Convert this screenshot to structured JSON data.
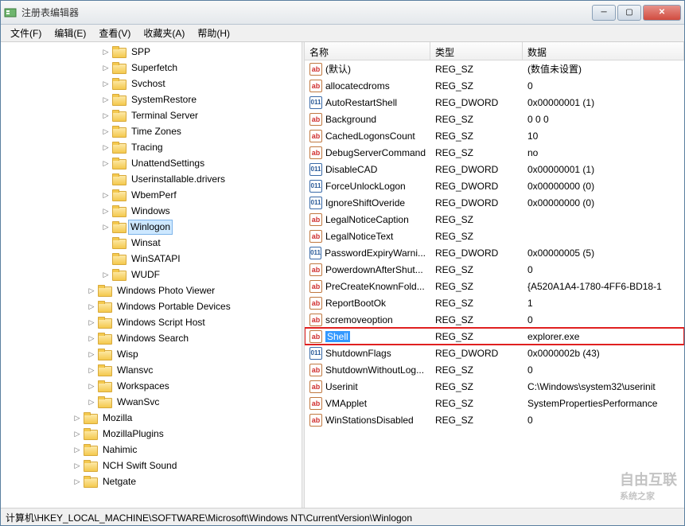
{
  "window": {
    "title": "注册表编辑器"
  },
  "menu": {
    "file": "文件(F)",
    "edit": "编辑(E)",
    "view": "查看(V)",
    "favorites": "收藏夹(A)",
    "help": "帮助(H)"
  },
  "tree": {
    "items": [
      {
        "depth": 7,
        "label": "SPP",
        "exp": true
      },
      {
        "depth": 7,
        "label": "Superfetch",
        "exp": true
      },
      {
        "depth": 7,
        "label": "Svchost",
        "exp": true
      },
      {
        "depth": 7,
        "label": "SystemRestore",
        "exp": true
      },
      {
        "depth": 7,
        "label": "Terminal Server",
        "exp": true
      },
      {
        "depth": 7,
        "label": "Time Zones",
        "exp": true
      },
      {
        "depth": 7,
        "label": "Tracing",
        "exp": true
      },
      {
        "depth": 7,
        "label": "UnattendSettings",
        "exp": true
      },
      {
        "depth": 7,
        "label": "Userinstallable.drivers",
        "exp": false
      },
      {
        "depth": 7,
        "label": "WbemPerf",
        "exp": true
      },
      {
        "depth": 7,
        "label": "Windows",
        "exp": true
      },
      {
        "depth": 7,
        "label": "Winlogon",
        "exp": true,
        "selected": true
      },
      {
        "depth": 7,
        "label": "Winsat",
        "exp": false
      },
      {
        "depth": 7,
        "label": "WinSATAPI",
        "exp": false
      },
      {
        "depth": 7,
        "label": "WUDF",
        "exp": true
      },
      {
        "depth": 6,
        "label": "Windows Photo Viewer",
        "exp": true
      },
      {
        "depth": 6,
        "label": "Windows Portable Devices",
        "exp": true
      },
      {
        "depth": 6,
        "label": "Windows Script Host",
        "exp": true
      },
      {
        "depth": 6,
        "label": "Windows Search",
        "exp": true
      },
      {
        "depth": 6,
        "label": "Wisp",
        "exp": true
      },
      {
        "depth": 6,
        "label": "Wlansvc",
        "exp": true
      },
      {
        "depth": 6,
        "label": "Workspaces",
        "exp": true
      },
      {
        "depth": 6,
        "label": "WwanSvc",
        "exp": true
      },
      {
        "depth": 5,
        "label": "Mozilla",
        "exp": true
      },
      {
        "depth": 5,
        "label": "MozillaPlugins",
        "exp": true
      },
      {
        "depth": 5,
        "label": "Nahimic",
        "exp": true
      },
      {
        "depth": 5,
        "label": "NCH Swift Sound",
        "exp": true
      },
      {
        "depth": 5,
        "label": "Netgate",
        "exp": true
      }
    ]
  },
  "list": {
    "headers": {
      "name": "名称",
      "type": "类型",
      "data": "数据"
    },
    "rows": [
      {
        "icon": "sz",
        "name": "(默认)",
        "type": "REG_SZ",
        "data": "(数值未设置)"
      },
      {
        "icon": "sz",
        "name": "allocatecdroms",
        "type": "REG_SZ",
        "data": "0"
      },
      {
        "icon": "dw",
        "name": "AutoRestartShell",
        "type": "REG_DWORD",
        "data": "0x00000001 (1)"
      },
      {
        "icon": "sz",
        "name": "Background",
        "type": "REG_SZ",
        "data": "0 0 0"
      },
      {
        "icon": "sz",
        "name": "CachedLogonsCount",
        "type": "REG_SZ",
        "data": "10"
      },
      {
        "icon": "sz",
        "name": "DebugServerCommand",
        "type": "REG_SZ",
        "data": "no"
      },
      {
        "icon": "dw",
        "name": "DisableCAD",
        "type": "REG_DWORD",
        "data": "0x00000001 (1)"
      },
      {
        "icon": "dw",
        "name": "ForceUnlockLogon",
        "type": "REG_DWORD",
        "data": "0x00000000 (0)"
      },
      {
        "icon": "dw",
        "name": "IgnoreShiftOveride",
        "type": "REG_DWORD",
        "data": "0x00000000 (0)"
      },
      {
        "icon": "sz",
        "name": "LegalNoticeCaption",
        "type": "REG_SZ",
        "data": ""
      },
      {
        "icon": "sz",
        "name": "LegalNoticeText",
        "type": "REG_SZ",
        "data": ""
      },
      {
        "icon": "dw",
        "name": "PasswordExpiryWarni...",
        "type": "REG_DWORD",
        "data": "0x00000005 (5)"
      },
      {
        "icon": "sz",
        "name": "PowerdownAfterShut...",
        "type": "REG_SZ",
        "data": "0"
      },
      {
        "icon": "sz",
        "name": "PreCreateKnownFold...",
        "type": "REG_SZ",
        "data": "{A520A1A4-1780-4FF6-BD18-1"
      },
      {
        "icon": "sz",
        "name": "ReportBootOk",
        "type": "REG_SZ",
        "data": "1"
      },
      {
        "icon": "sz",
        "name": "scremoveoption",
        "type": "REG_SZ",
        "data": "0"
      },
      {
        "icon": "sz",
        "name": "Shell",
        "type": "REG_SZ",
        "data": "explorer.exe",
        "highlight": true
      },
      {
        "icon": "dw",
        "name": "ShutdownFlags",
        "type": "REG_DWORD",
        "data": "0x0000002b (43)"
      },
      {
        "icon": "sz",
        "name": "ShutdownWithoutLog...",
        "type": "REG_SZ",
        "data": "0"
      },
      {
        "icon": "sz",
        "name": "Userinit",
        "type": "REG_SZ",
        "data": "C:\\Windows\\system32\\userinit"
      },
      {
        "icon": "sz",
        "name": "VMApplet",
        "type": "REG_SZ",
        "data": "SystemPropertiesPerformance"
      },
      {
        "icon": "sz",
        "name": "WinStationsDisabled",
        "type": "REG_SZ",
        "data": "0"
      }
    ]
  },
  "statusbar": {
    "path": "计算机\\HKEY_LOCAL_MACHINE\\SOFTWARE\\Microsoft\\Windows NT\\CurrentVersion\\Winlogon"
  },
  "watermark": {
    "line1": "自由互联",
    "line2": "系统之家"
  }
}
